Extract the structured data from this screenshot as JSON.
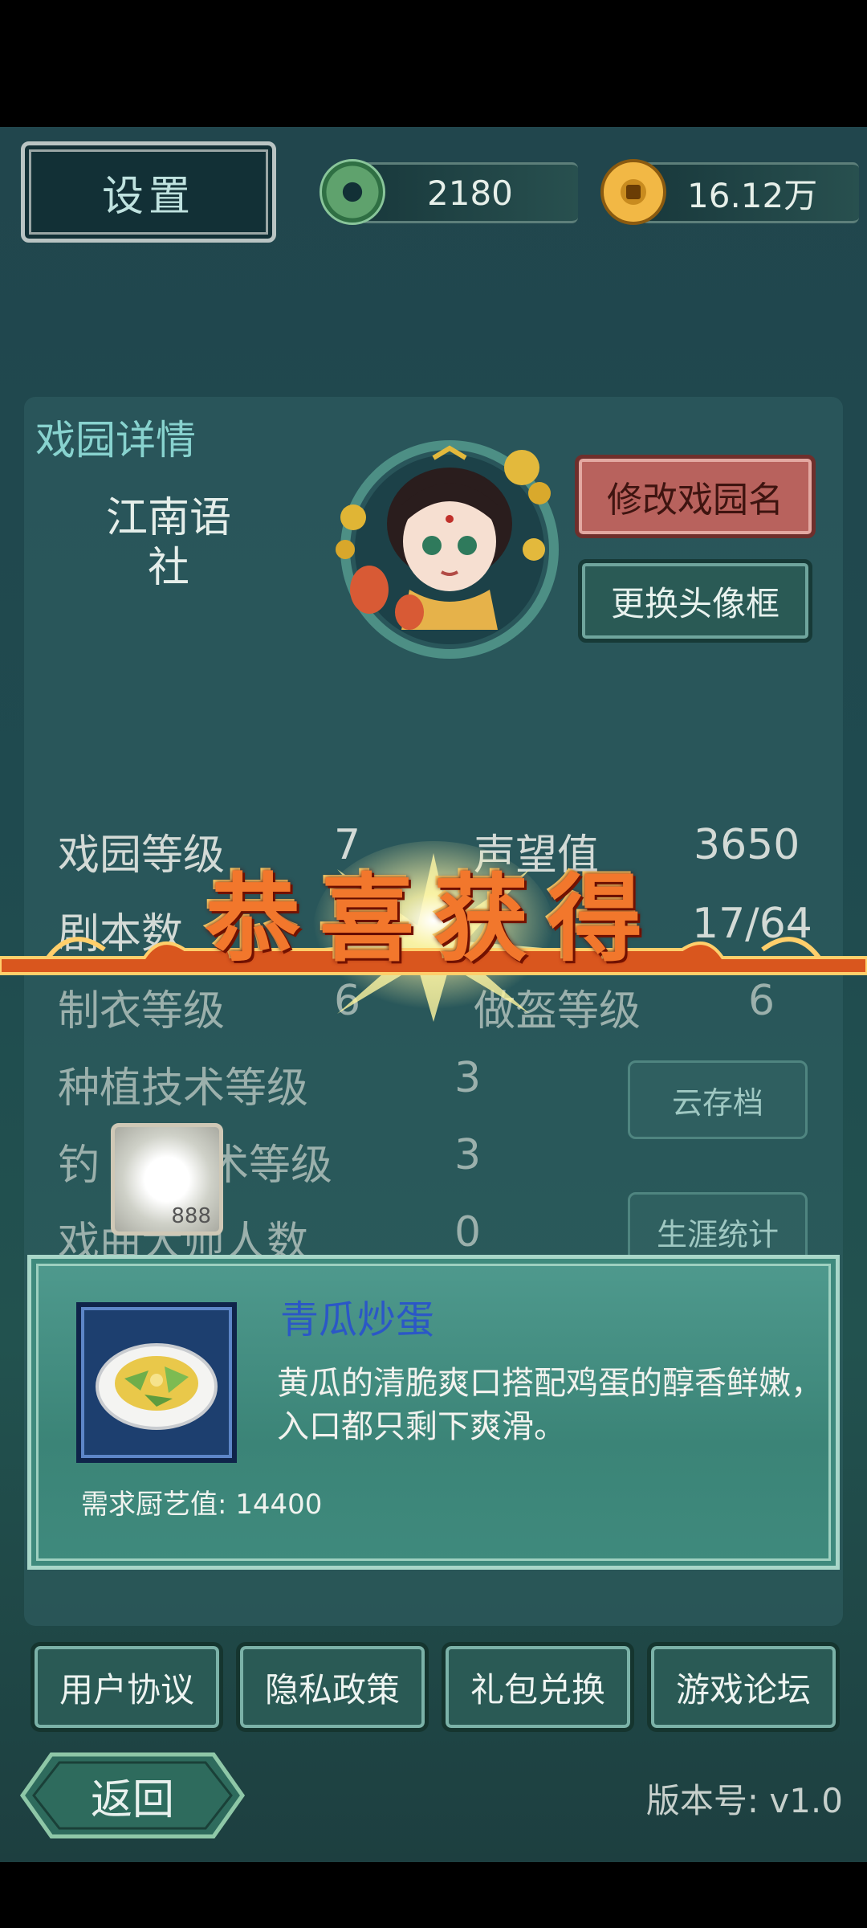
{
  "header": {
    "settings_label": "设置",
    "jade_amount": "2180",
    "coin_amount": "16.12万"
  },
  "panel": {
    "title": "戏园详情",
    "garden_name": "江南语\n社",
    "rename_label": "修改戏园名",
    "change_frame_label": "更换头像框",
    "stats": {
      "garden_level_label": "戏园等级",
      "garden_level_value": "7",
      "reputation_label": "声望值",
      "reputation_value": "3650",
      "script_count_label": "剧本数",
      "script_count_value": "17/64",
      "tailoring_label": "制衣等级",
      "tailoring_value": "6",
      "headwear_label": "做盔等级",
      "headwear_value": "6",
      "planting_label": "种植技术等级",
      "planting_value": "3",
      "fishing_label": "钓",
      "fishing_suffix": "术等级",
      "fishing_value": "3",
      "masters_label": "戏曲大师人数",
      "masters_value": "0"
    },
    "cloud_save_label": "云存档",
    "career_stats_label": "生涯统计",
    "item_count": "888"
  },
  "banner": {
    "text": "恭喜获得"
  },
  "reward": {
    "name": "青瓜炒蛋",
    "description": "黄瓜的清脆爽口搭配鸡蛋的醇香鲜嫩，入口都只剩下爽滑。",
    "requirement": "需求厨艺值: 14400"
  },
  "footer": {
    "buttons": [
      "用户协议",
      "隐私政策",
      "礼包兑换",
      "游戏论坛"
    ],
    "back_label": "返回",
    "version": "版本号: v1.0"
  }
}
